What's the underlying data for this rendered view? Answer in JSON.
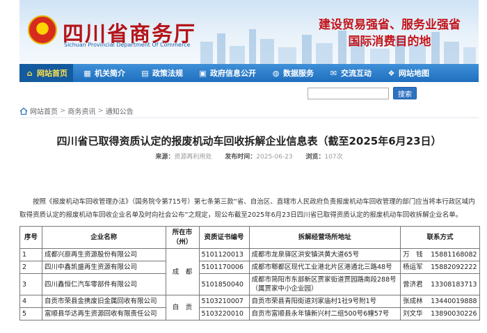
{
  "header": {
    "site_title": "四川省商务厅",
    "site_subtitle": "Sichuan Provincial Department Of Commerce",
    "slogan_line1": "建设贸易强省、服务业强省",
    "slogan_line2": "国际消费目的地"
  },
  "nav": {
    "items": [
      {
        "label": "网站首页",
        "icon": "home-icon"
      },
      {
        "label": "机关简介",
        "icon": "org-icon"
      },
      {
        "label": "政策法规",
        "icon": "law-icon"
      },
      {
        "label": "政府信息公开",
        "icon": "info-icon"
      },
      {
        "label": "数据服务",
        "icon": "data-icon"
      },
      {
        "label": "交流互动",
        "icon": "chat-icon"
      },
      {
        "label": "网站地图",
        "icon": "sitemap-icon"
      }
    ]
  },
  "search": {
    "button_label": "搜索",
    "value": ""
  },
  "breadcrumb": {
    "items": [
      "网站首页",
      "商务资讯",
      "通知公告"
    ],
    "separator": ">"
  },
  "article": {
    "title": "四川省已取得资质认定的报废机动车回收拆解企业信息表（截至2025年6月23日）",
    "source_label": "来源：",
    "source": "资源再利用处",
    "date_label": "发布时间：",
    "date": "2025-06-23",
    "views_label": "浏览：",
    "views": "107次",
    "intro": "按照《报废机动车回收管理办法》（国务院令第715号）第七条第三款“省、自治区、直辖市人民政府负责报废机动车回收管理的部门应当将本行政区域内取得资质认定的报废机动车回收企业名单及时向社会公布”之规定，现公布截至2025年6月23日四川省已取得资质认定的报废机动车回收拆解企业名单。"
  },
  "table": {
    "headers": [
      "序号",
      "企业名称",
      "所在市（州）",
      "资质证书编号",
      "拆解经营场所地址",
      "联系方式"
    ],
    "rows": [
      {
        "no": "1",
        "name": "成都兴原再生资源股份有限公司",
        "cert": "5101120013",
        "address": "成都市龙泉驿区洪安镇洪黄大道65号",
        "contact": "万　钱",
        "phone": "15881168082"
      },
      {
        "no": "2",
        "name": "四川中鑫凯盛再生资源有限公司",
        "cert": "5101170006",
        "address": "成都市郫都区现代工业港北片区港通北三路48号",
        "contact": "杨运军",
        "phone": "15882092222"
      },
      {
        "no": "3",
        "name": "四川鑫恒仁汽车零部件有限公司",
        "cert": "5101850040",
        "address": "成都市简阳市东部新区贾家街道贾园路南段288号（属贾家中小企业园）",
        "contact": "曾济君",
        "phone": "13308183713"
      },
      {
        "no": "4",
        "name": "自贡市荣县金携废旧金属回收有限公司",
        "cert": "5103210007",
        "address": "自贡市荣县青阳街道刘家庙村1社9号附1号",
        "contact": "张成林",
        "phone": "13440019888"
      },
      {
        "no": "5",
        "name": "富顺县华达再生资源回收有限责任公司",
        "cert": "5103220010",
        "address": "自贡市富顺县永年镇新兴村二组500号6幢57号",
        "contact": "刘文华",
        "phone": "13890030226"
      }
    ],
    "city_chengdu": "成　都",
    "city_zigong": "自　贡"
  }
}
